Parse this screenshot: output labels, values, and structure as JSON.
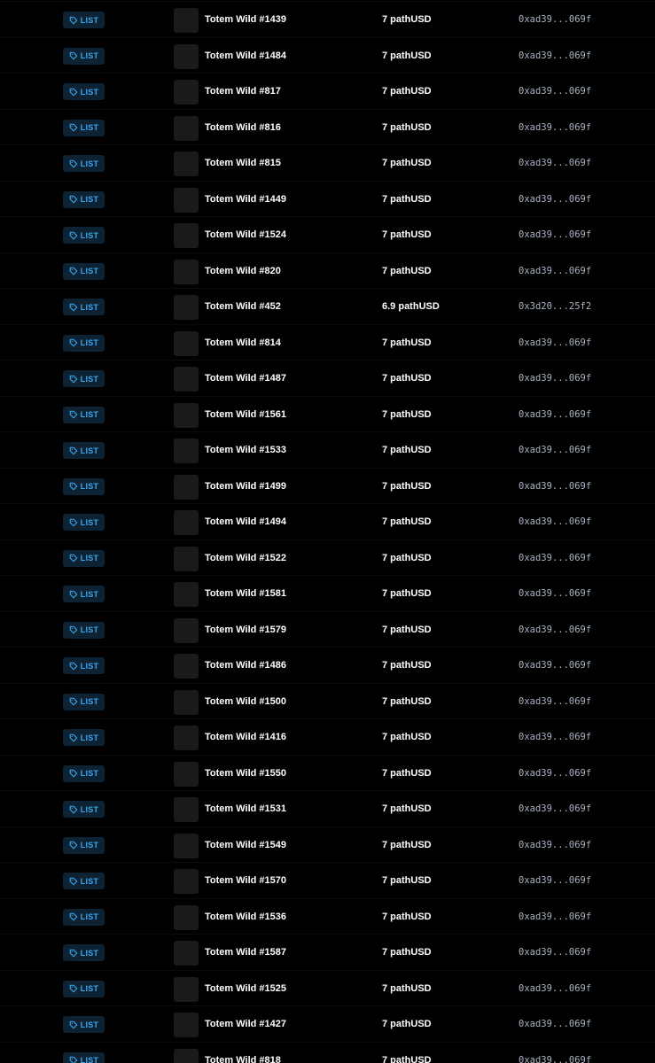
{
  "colors": {
    "background": "#000000",
    "badge_bg": "#0d2233",
    "badge_text": "#3aa7f0",
    "thumb_bg": "#1a1a1a",
    "address_text": "#a9b4c2"
  },
  "badge_icon": "tag-icon",
  "rows": [
    {
      "event": "LIST",
      "name": "Totem Wild #1439",
      "price": "7 pathUSD",
      "address": "0xad39...069f"
    },
    {
      "event": "LIST",
      "name": "Totem Wild #1484",
      "price": "7 pathUSD",
      "address": "0xad39...069f"
    },
    {
      "event": "LIST",
      "name": "Totem Wild #817",
      "price": "7 pathUSD",
      "address": "0xad39...069f"
    },
    {
      "event": "LIST",
      "name": "Totem Wild #816",
      "price": "7 pathUSD",
      "address": "0xad39...069f"
    },
    {
      "event": "LIST",
      "name": "Totem Wild #815",
      "price": "7 pathUSD",
      "address": "0xad39...069f"
    },
    {
      "event": "LIST",
      "name": "Totem Wild #1449",
      "price": "7 pathUSD",
      "address": "0xad39...069f"
    },
    {
      "event": "LIST",
      "name": "Totem Wild #1524",
      "price": "7 pathUSD",
      "address": "0xad39...069f"
    },
    {
      "event": "LIST",
      "name": "Totem Wild #820",
      "price": "7 pathUSD",
      "address": "0xad39...069f"
    },
    {
      "event": "LIST",
      "name": "Totem Wild #452",
      "price": "6.9 pathUSD",
      "address": "0x3d20...25f2"
    },
    {
      "event": "LIST",
      "name": "Totem Wild #814",
      "price": "7 pathUSD",
      "address": "0xad39...069f"
    },
    {
      "event": "LIST",
      "name": "Totem Wild #1487",
      "price": "7 pathUSD",
      "address": "0xad39...069f"
    },
    {
      "event": "LIST",
      "name": "Totem Wild #1561",
      "price": "7 pathUSD",
      "address": "0xad39...069f"
    },
    {
      "event": "LIST",
      "name": "Totem Wild #1533",
      "price": "7 pathUSD",
      "address": "0xad39...069f"
    },
    {
      "event": "LIST",
      "name": "Totem Wild #1499",
      "price": "7 pathUSD",
      "address": "0xad39...069f"
    },
    {
      "event": "LIST",
      "name": "Totem Wild #1494",
      "price": "7 pathUSD",
      "address": "0xad39...069f"
    },
    {
      "event": "LIST",
      "name": "Totem Wild #1522",
      "price": "7 pathUSD",
      "address": "0xad39...069f"
    },
    {
      "event": "LIST",
      "name": "Totem Wild #1581",
      "price": "7 pathUSD",
      "address": "0xad39...069f"
    },
    {
      "event": "LIST",
      "name": "Totem Wild #1579",
      "price": "7 pathUSD",
      "address": "0xad39...069f"
    },
    {
      "event": "LIST",
      "name": "Totem Wild #1486",
      "price": "7 pathUSD",
      "address": "0xad39...069f"
    },
    {
      "event": "LIST",
      "name": "Totem Wild #1500",
      "price": "7 pathUSD",
      "address": "0xad39...069f"
    },
    {
      "event": "LIST",
      "name": "Totem Wild #1416",
      "price": "7 pathUSD",
      "address": "0xad39...069f"
    },
    {
      "event": "LIST",
      "name": "Totem Wild #1550",
      "price": "7 pathUSD",
      "address": "0xad39...069f"
    },
    {
      "event": "LIST",
      "name": "Totem Wild #1531",
      "price": "7 pathUSD",
      "address": "0xad39...069f"
    },
    {
      "event": "LIST",
      "name": "Totem Wild #1549",
      "price": "7 pathUSD",
      "address": "0xad39...069f"
    },
    {
      "event": "LIST",
      "name": "Totem Wild #1570",
      "price": "7 pathUSD",
      "address": "0xad39...069f"
    },
    {
      "event": "LIST",
      "name": "Totem Wild #1536",
      "price": "7 pathUSD",
      "address": "0xad39...069f"
    },
    {
      "event": "LIST",
      "name": "Totem Wild #1587",
      "price": "7 pathUSD",
      "address": "0xad39...069f"
    },
    {
      "event": "LIST",
      "name": "Totem Wild #1525",
      "price": "7 pathUSD",
      "address": "0xad39...069f"
    },
    {
      "event": "LIST",
      "name": "Totem Wild #1427",
      "price": "7 pathUSD",
      "address": "0xad39...069f"
    },
    {
      "event": "LIST",
      "name": "Totem Wild #818",
      "price": "7 pathUSD",
      "address": "0xad39...069f"
    }
  ]
}
